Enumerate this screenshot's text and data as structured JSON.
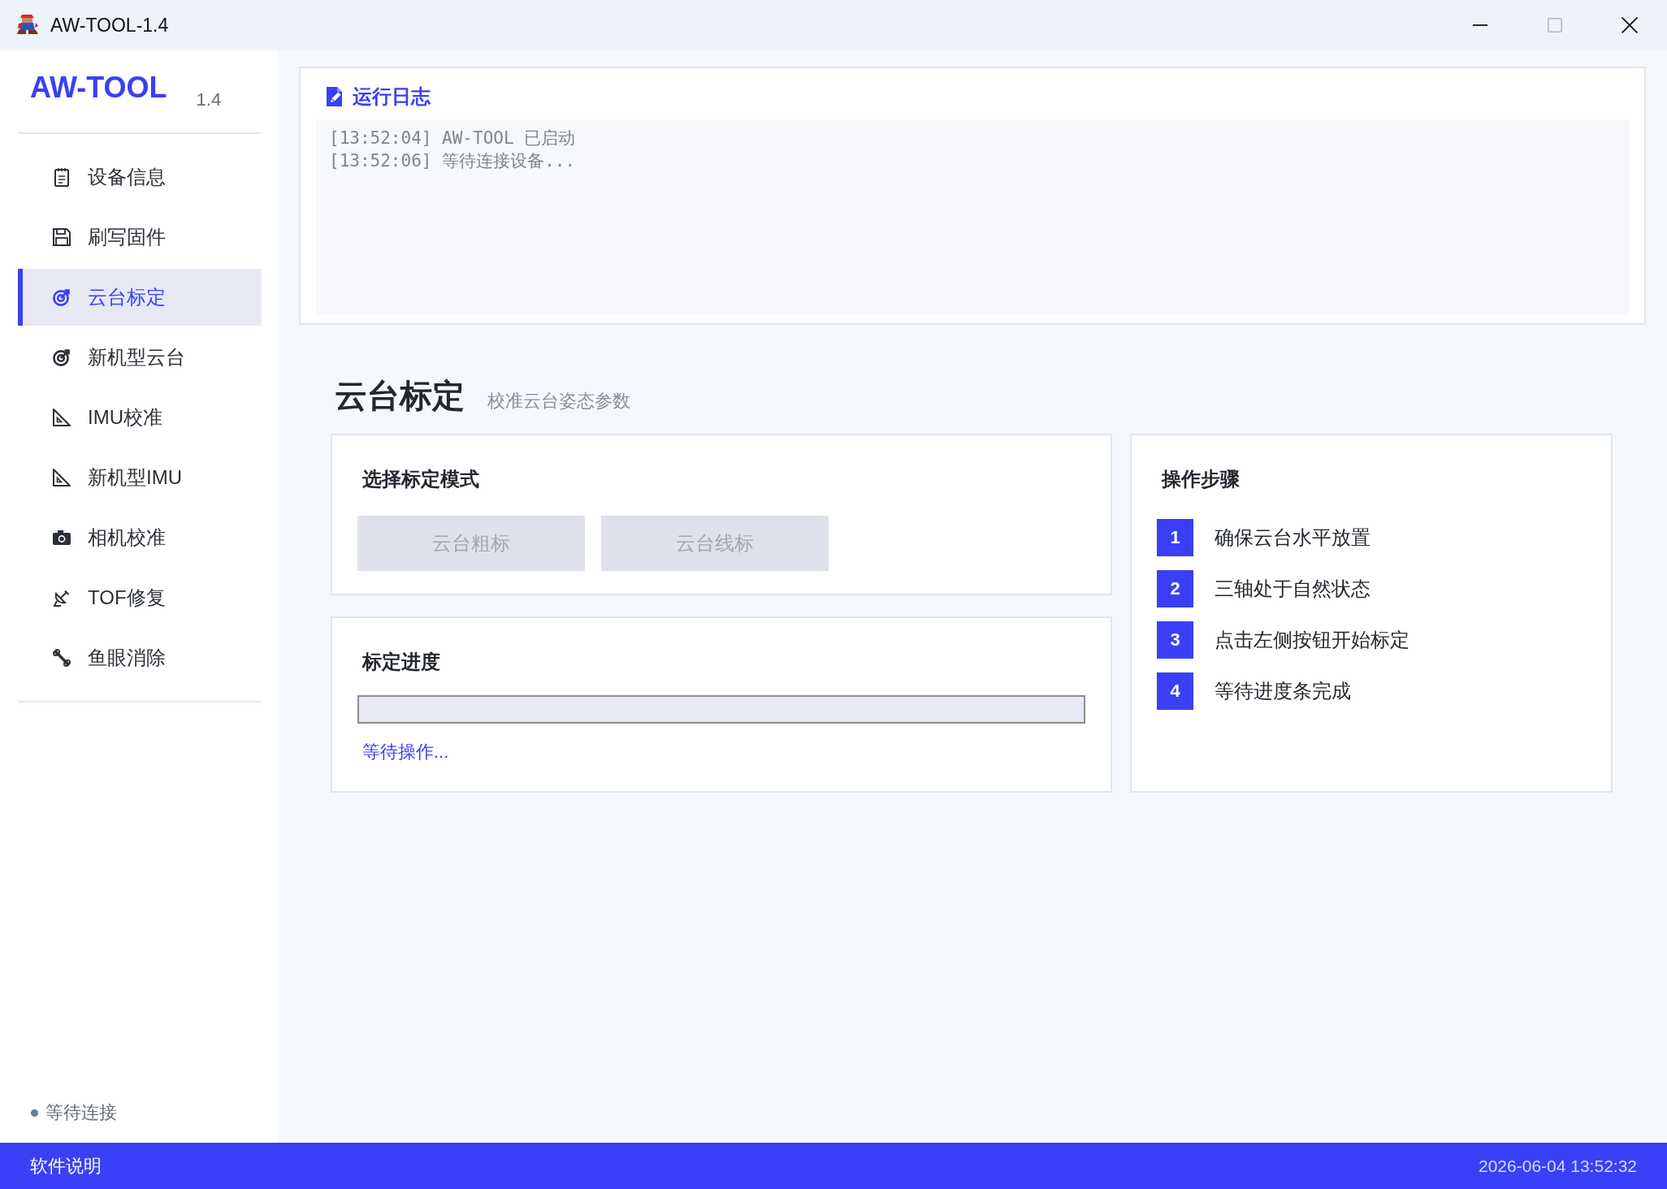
{
  "window": {
    "title": "AW-TOOL-1.4",
    "controls": [
      {
        "kind": "minimize",
        "disabled": false
      },
      {
        "kind": "maximize",
        "disabled": true
      },
      {
        "kind": "close",
        "disabled": false
      }
    ]
  },
  "sidebar": {
    "logo": "AW-TOOL",
    "version": "1.4",
    "items": [
      {
        "label": "设备信息",
        "selected": false
      },
      {
        "label": "刷写固件",
        "selected": false
      },
      {
        "label": "云台标定",
        "selected": true
      },
      {
        "label": "新机型云台",
        "selected": false
      },
      {
        "label": "IMU校准",
        "selected": false
      },
      {
        "label": "新机型IMU",
        "selected": false
      },
      {
        "label": "相机校准",
        "selected": false
      },
      {
        "label": "TOF修复",
        "selected": false
      },
      {
        "label": "鱼眼消除",
        "selected": false
      }
    ],
    "status": "等待连接"
  },
  "log": {
    "title": "运行日志",
    "lines": [
      "[13:52:04] AW-TOOL 已启动",
      "[13:52:06] 等待连接设备..."
    ]
  },
  "page": {
    "title": "云台标定",
    "subtitle": "校准云台姿态参数"
  },
  "mode_card": {
    "title": "选择标定模式",
    "buttons": [
      {
        "label": "云台粗标",
        "disabled": true
      },
      {
        "label": "云台线标",
        "disabled": true
      }
    ]
  },
  "progress_card": {
    "title": "标定进度",
    "level": 0,
    "status": "等待操作..."
  },
  "steps_card": {
    "title": "操作步骤",
    "steps": [
      {
        "number": "1",
        "text": "确保云台水平放置"
      },
      {
        "number": "2",
        "text": "三轴处于自然状态"
      },
      {
        "number": "3",
        "text": "点击左侧按钮开始标定"
      },
      {
        "number": "4",
        "text": "等待进度条完成"
      }
    ]
  },
  "status_bar": {
    "help": "软件说明",
    "datetime": "2026-06-04 13:52:32"
  }
}
